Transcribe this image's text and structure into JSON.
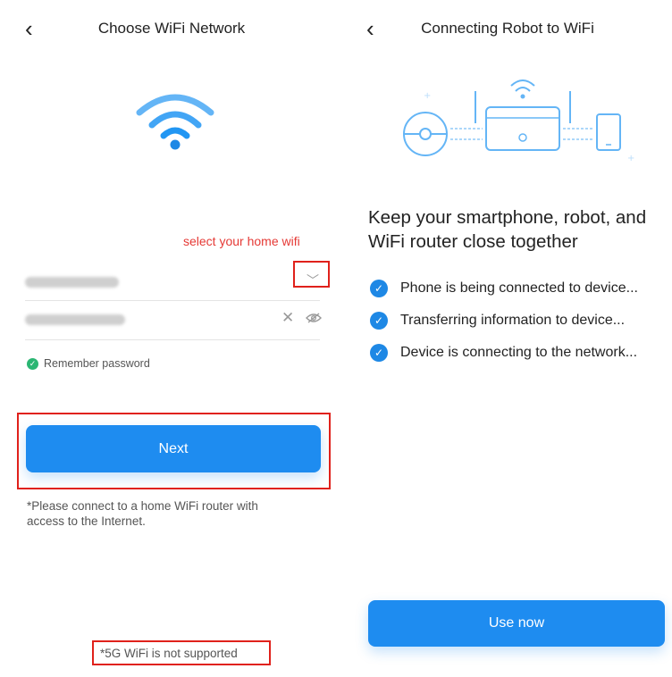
{
  "left": {
    "title": "Choose WiFi Network",
    "hint": "select your home wifi",
    "remember_label": "Remember password",
    "next_label": "Next",
    "note": "*Please connect to a home WiFi router with access to the Internet.",
    "five_g_note": "*5G WiFi is not supported"
  },
  "right": {
    "title": "Connecting Robot to WiFi",
    "headline": "Keep your smartphone, robot, and WiFi router close together",
    "steps": [
      "Phone is being connected to device...",
      "Transferring information to device...",
      "Device is connecting to the network..."
    ],
    "use_now_label": "Use now"
  },
  "colors": {
    "accent": "#1e8cf0",
    "annotation": "#e0211b",
    "success": "#2bb673"
  }
}
